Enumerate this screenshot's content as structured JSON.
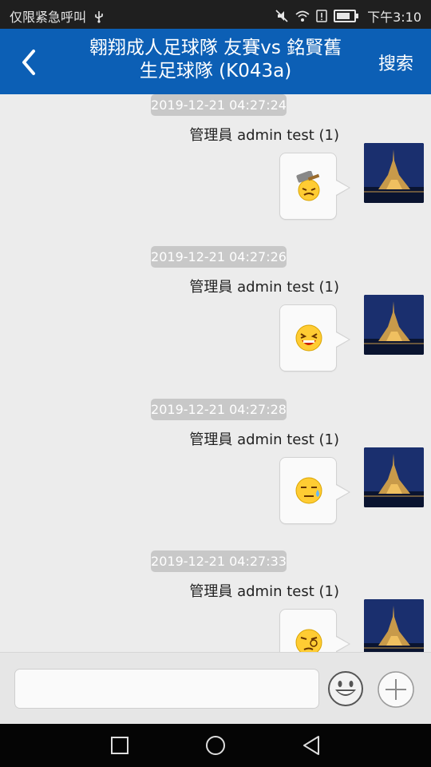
{
  "status_bar": {
    "left_text": "仅限紧急呼叫",
    "usb_icon": "usb-icon",
    "time": "下午3:10",
    "icons": [
      "mute-icon",
      "wifi-icon",
      "sim-alert-icon",
      "battery-charging-icon"
    ]
  },
  "header": {
    "title_line1": "翱翔成人足球隊 友賽vs 銘賢舊",
    "title_line2": "生足球隊 (K043a)",
    "search_label": "搜索",
    "back_icon": "back-arrow-icon",
    "background_color": "#0c5fb5"
  },
  "messages": [
    {
      "timestamp": "2019-12-21 04:27:24",
      "sender": "管理員 admin test (1)",
      "emoji": "hammer-on-head-emoji"
    },
    {
      "timestamp": "2019-12-21 04:27:26",
      "sender": "管理員 admin test (1)",
      "emoji": "laughing-emoji"
    },
    {
      "timestamp": "2019-12-21 04:27:28",
      "sender": "管理員 admin test (1)",
      "emoji": "sweat-emoji"
    },
    {
      "timestamp": "2019-12-21 04:27:33",
      "sender": "管理員 admin test (1)",
      "emoji": "thinking-emoji"
    }
  ],
  "input_bar": {
    "value": "",
    "emoji_button_icon": "smiley-face-icon",
    "plus_button_icon": "plus-circle-icon"
  },
  "nav_bar": {
    "buttons": [
      "recents-square-icon",
      "home-circle-icon",
      "back-triangle-icon"
    ]
  }
}
